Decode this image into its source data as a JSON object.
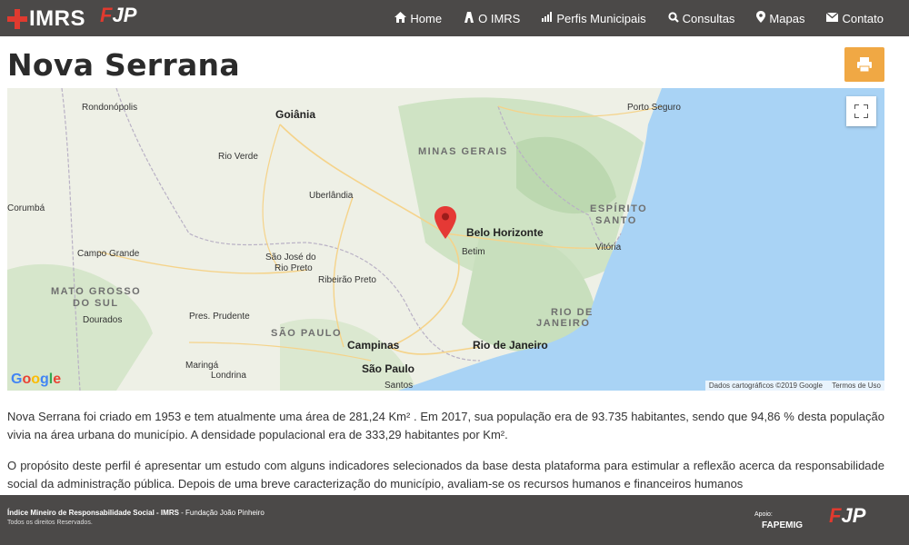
{
  "header": {
    "logo_imrs": "IMRS",
    "logo_fjp_a": "F",
    "logo_fjp_b": "JP",
    "nav": [
      {
        "label": "Home",
        "icon": "home-icon"
      },
      {
        "label": "O IMRS",
        "icon": "building-icon"
      },
      {
        "label": "Perfis Municipais",
        "icon": "bar-chart-icon"
      },
      {
        "label": "Consultas",
        "icon": "search-icon"
      },
      {
        "label": "Mapas",
        "icon": "map-marker-icon"
      },
      {
        "label": "Contato",
        "icon": "envelope-icon"
      }
    ]
  },
  "page": {
    "title": "Nova Serrana",
    "print_icon": "print-icon",
    "accent_color": "#f0a844"
  },
  "map": {
    "labels": {
      "rondonopolis": "Rondonópolis",
      "goiania": "Goiânia",
      "minas_gerais": "MINAS GERAIS",
      "porto_seguro": "Porto Seguro",
      "rio_verde": "Rio Verde",
      "uberlandia": "Uberlândia",
      "corumba": "Corumbá",
      "espirito": "ESPÍRITO",
      "santo": "SANTO",
      "belo_horizonte": "Belo Horizonte",
      "betim": "Betim",
      "vitoria": "Vitória",
      "campo_grande": "Campo Grande",
      "sao_jose": "São José do",
      "rio_preto": "Rio Preto",
      "ribeirao_preto": "Ribeirão Preto",
      "mato_grosso": "MATO GROSSO",
      "do_sul": "DO SUL",
      "rio_de": "RIO DE",
      "janeiro": "JANEIRO",
      "dourados": "Dourados",
      "pres_prudente": "Pres. Prudente",
      "sao_paulo_state": "SÃO PAULO",
      "campinas": "Campinas",
      "rio_de_janeiro": "Rio de Janeiro",
      "maringa": "Maringá",
      "londrina": "Londrina",
      "sao_paulo": "São Paulo",
      "santos": "Santos"
    },
    "google": "Google",
    "attribution": "Dados cartográficos ©2019 Google",
    "terms": "Termos de Uso"
  },
  "body": {
    "paragraph1": "Nova Serrana foi criado em 1953 e tem atualmente uma área de 281,24 Km² . Em 2017, sua população era de 93.735 habitantes, sendo que 94,86 % desta população vivia na área urbana do município. A densidade populacional era de 333,29 habitantes por Km².",
    "paragraph2": "O propósito deste perfil é apresentar um estudo com alguns indicadores selecionados da base desta plataforma para estimular a reflexão acerca da responsabilidade social da administração pública. Depois de uma breve caracterização do município, avaliam-se os recursos humanos e financeiros humanos"
  },
  "footer": {
    "line1_bold": "Índice Mineiro de Responsabilidade Social - IMRS",
    "line1_rest": " - Fundação João Pinheiro",
    "line2": "Todos os direitos Reservados.",
    "apoio": "Apoio:",
    "fapemig": "FAPEMIG",
    "fjp_a": "F",
    "fjp_b": "JP"
  }
}
